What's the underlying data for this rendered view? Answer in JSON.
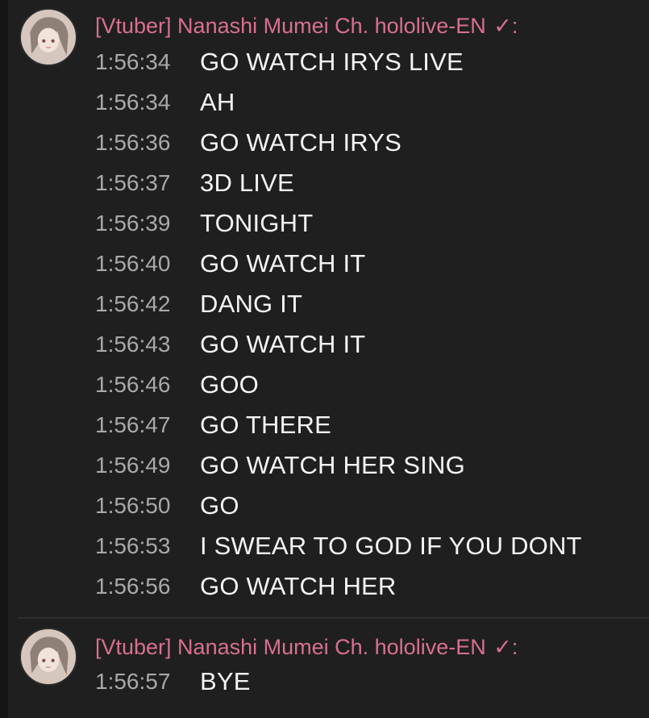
{
  "messages_group_1": {
    "author": "[Vtuber] Nanashi Mumei Ch. hololive-EN",
    "verified_mark": "✓:",
    "items": [
      {
        "time": "1:56:34",
        "text": "GO WATCH IRYS LIVE"
      },
      {
        "time": "1:56:34",
        "text": "AH"
      },
      {
        "time": "1:56:36",
        "text": "GO WATCH IRYS"
      },
      {
        "time": "1:56:37",
        "text": "3D LIVE"
      },
      {
        "time": "1:56:39",
        "text": "TONIGHT"
      },
      {
        "time": "1:56:40",
        "text": "GO WATCH IT"
      },
      {
        "time": "1:56:42",
        "text": "DANG IT"
      },
      {
        "time": "1:56:43",
        "text": "GO WATCH IT"
      },
      {
        "time": "1:56:46",
        "text": "GOO"
      },
      {
        "time": "1:56:47",
        "text": "GO THERE"
      },
      {
        "time": "1:56:49",
        "text": "GO WATCH HER SING"
      },
      {
        "time": "1:56:50",
        "text": "GO"
      },
      {
        "time": "1:56:53",
        "text": "I SWEAR TO GOD IF YOU DONT"
      },
      {
        "time": "1:56:56",
        "text": "GO WATCH HER"
      }
    ]
  },
  "messages_group_2": {
    "author": "[Vtuber] Nanashi Mumei Ch. hololive-EN",
    "verified_mark": "✓:",
    "items": [
      {
        "time": "1:56:57",
        "text": "BYE"
      }
    ]
  },
  "colors": {
    "background": "#1f1f1f",
    "author": "#d9708e",
    "timestamp": "#a9a9a9",
    "message": "#f4f4f4"
  },
  "icons": {
    "avatar": "avatar-icon",
    "verified": "verified-check-icon"
  }
}
